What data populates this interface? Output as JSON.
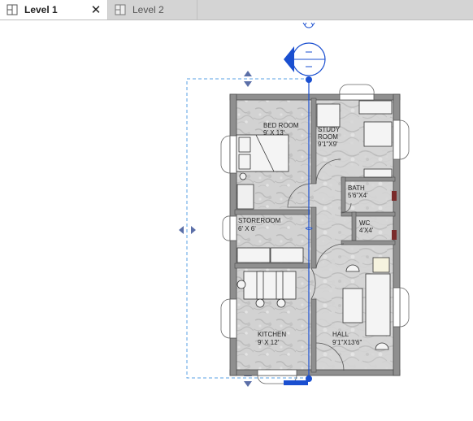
{
  "tabs": [
    {
      "label": "Level 1",
      "active": true
    },
    {
      "label": "Level 2",
      "active": false
    }
  ],
  "icons": {
    "tab_view": "floor-plan-view-icon",
    "close": "close-icon"
  },
  "rooms": {
    "bedroom": {
      "name": "BED ROOM",
      "size": "9' X 13'"
    },
    "study": {
      "name": "STUDY",
      "name2": "ROOM",
      "size": "9'1\"X9'"
    },
    "bath": {
      "name": "BATH",
      "size": "5'6\"X4'"
    },
    "wc": {
      "name": "WC",
      "size": "4'X4'"
    },
    "storeroom": {
      "name": "STOREROOM",
      "size": "6' X 6'"
    },
    "kitchen": {
      "name": "KITCHEN",
      "size": "9' X 12'"
    },
    "hall": {
      "name": "HALL",
      "size": "9'1\"X13'6\""
    }
  },
  "colors": {
    "wall": "#8f8f8f",
    "floor": "#d3d3d3",
    "section_line": "#1a4fd0",
    "crop_dashed": "#5aa0e6",
    "door_accent": "#7a2b2b"
  }
}
